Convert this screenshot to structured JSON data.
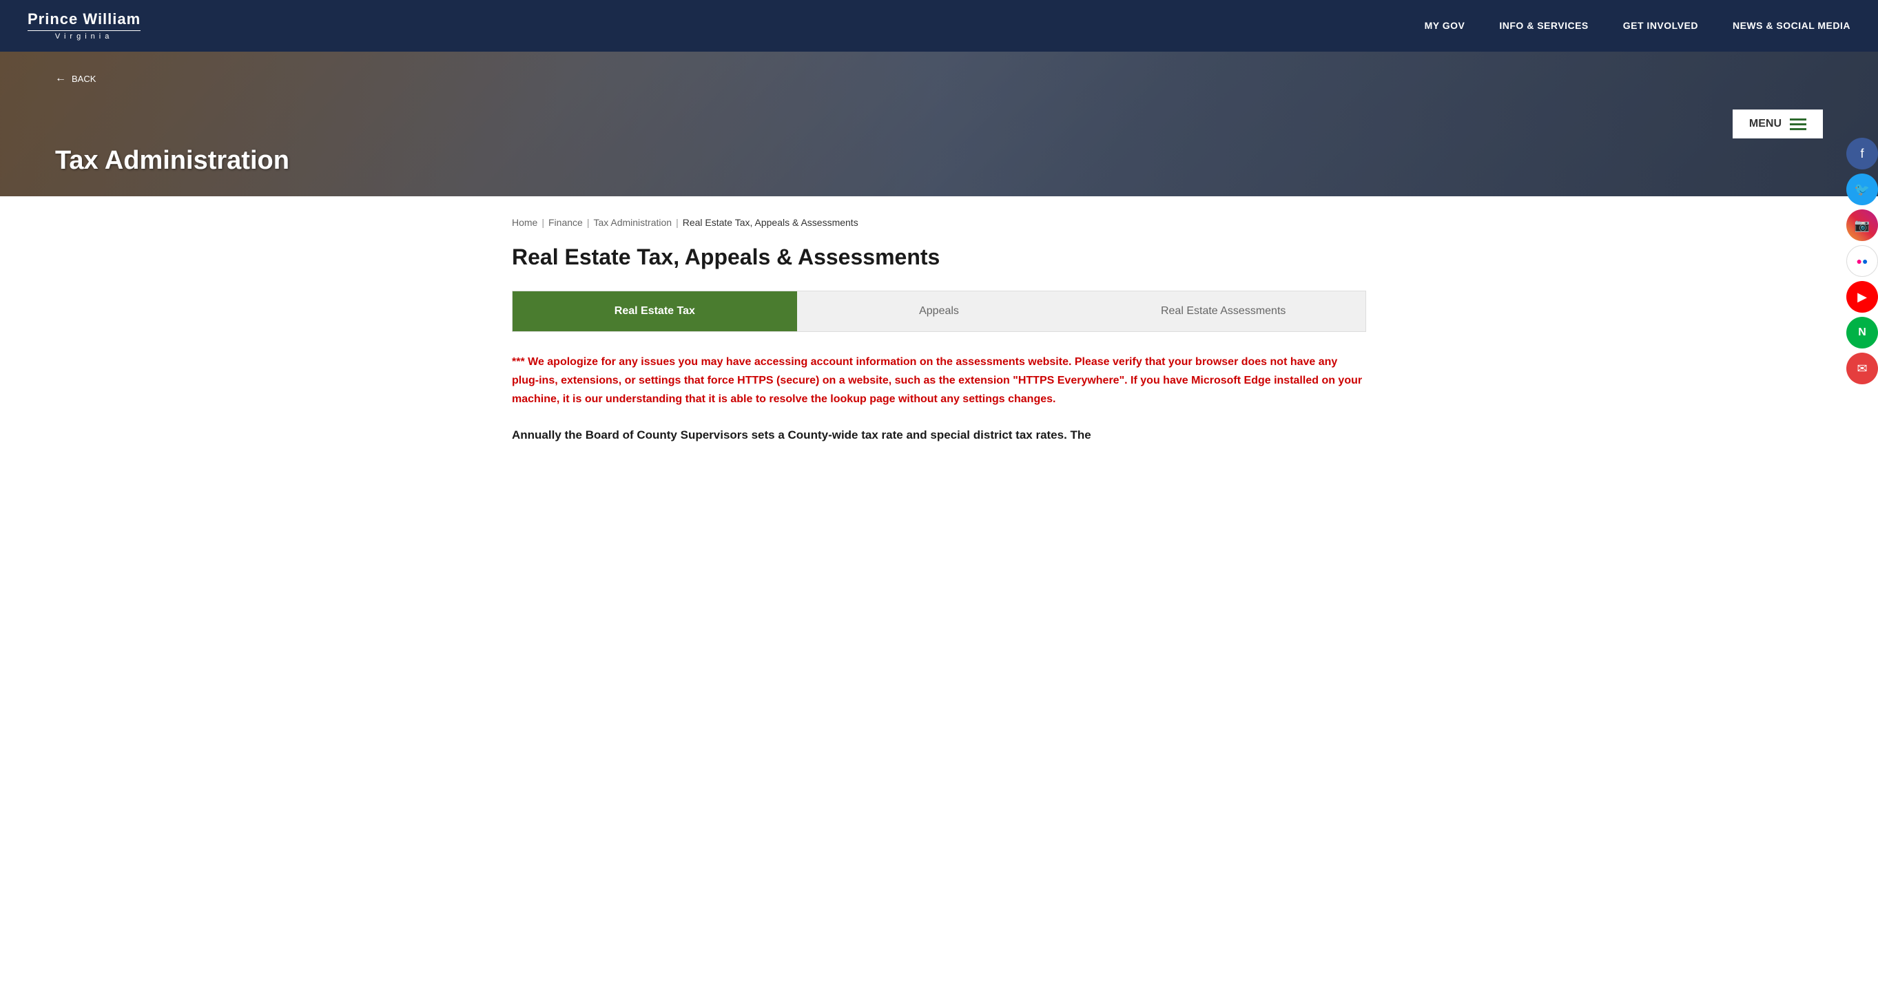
{
  "header": {
    "logo_main": "Prince William",
    "logo_sub": "Virginia",
    "nav": [
      {
        "label": "MY GOV",
        "id": "my-gov"
      },
      {
        "label": "INFO & SERVICES",
        "id": "info-services"
      },
      {
        "label": "GET INVOLVED",
        "id": "get-involved"
      },
      {
        "label": "NEWS & SOCIAL MEDIA",
        "id": "news-social"
      }
    ]
  },
  "hero": {
    "back_label": "BACK",
    "title": "Tax Administration",
    "menu_label": "MENU"
  },
  "breadcrumb": {
    "home": "Home",
    "finance": "Finance",
    "tax_admin": "Tax Administration",
    "current": "Real Estate Tax, Appeals & Assessments"
  },
  "page": {
    "title": "Real Estate Tax, Appeals & Assessments"
  },
  "tabs": [
    {
      "label": "Real Estate Tax",
      "active": true,
      "id": "real-estate-tax"
    },
    {
      "label": "Appeals",
      "active": false,
      "id": "appeals"
    },
    {
      "label": "Real Estate Assessments",
      "active": false,
      "id": "real-estate-assessments"
    }
  ],
  "alert": {
    "text": "*** We apologize for any issues you may have accessing account information on the assessments website. Please verify that your browser does not have any plug-ins, extensions, or settings that force HTTPS (secure) on a website, such as the extension \"HTTPS Everywhere\". If you have Microsoft Edge installed on your machine, it is our understanding that it is able to resolve the lookup page without any settings changes."
  },
  "body": {
    "text": "Annually the Board of County Supervisors sets a County-wide tax rate and special district tax rates. The"
  },
  "social": [
    {
      "label": "Facebook",
      "icon": "f",
      "class": "social-facebook"
    },
    {
      "label": "Twitter",
      "icon": "t",
      "class": "social-twitter"
    },
    {
      "label": "Instagram",
      "icon": "📷",
      "class": "social-instagram"
    },
    {
      "label": "Flickr",
      "icon": "●●",
      "class": "social-flickr"
    },
    {
      "label": "YouTube",
      "icon": "▶",
      "class": "social-youtube"
    },
    {
      "label": "Nextdoor",
      "icon": "N",
      "class": "social-nextdoor"
    },
    {
      "label": "Email",
      "icon": "✉",
      "class": "social-email"
    }
  ]
}
